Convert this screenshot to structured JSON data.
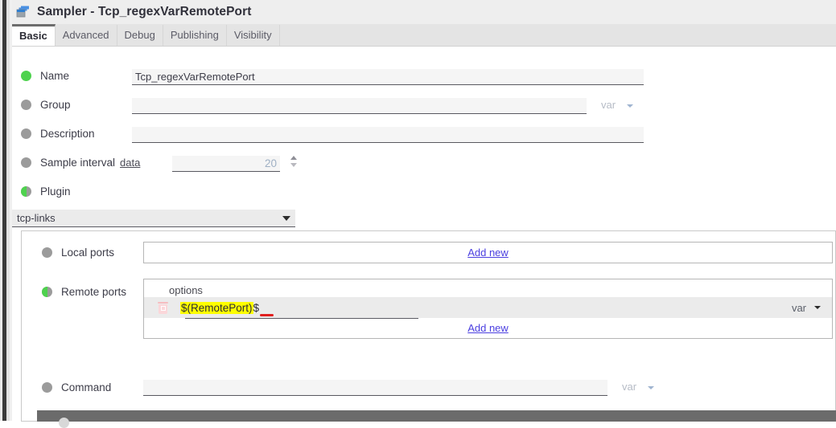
{
  "window": {
    "title": "Sampler - Tcp_regexVarRemotePort",
    "icon": "cascading-windows-icon"
  },
  "tabs": [
    {
      "label": "Basic",
      "active": true
    },
    {
      "label": "Advanced",
      "active": false
    },
    {
      "label": "Debug",
      "active": false
    },
    {
      "label": "Publishing",
      "active": false
    },
    {
      "label": "Visibility",
      "active": false
    }
  ],
  "form": {
    "name": {
      "label": "Name",
      "value": "Tcp_regexVarRemotePort",
      "status": "green"
    },
    "group": {
      "label": "Group",
      "value": "",
      "status": "grey",
      "var_label": "var"
    },
    "description": {
      "label": "Description",
      "value": "",
      "status": "grey"
    },
    "sample_interval": {
      "label": "Sample interval",
      "link": "data",
      "value": "20",
      "status": "grey"
    },
    "plugin": {
      "label": "Plugin",
      "status": "half",
      "selected": "tcp-links"
    }
  },
  "plugin_panel": {
    "local_ports": {
      "label": "Local ports",
      "status": "grey",
      "add_new": "Add new"
    },
    "remote_ports": {
      "label": "Remote ports",
      "status": "half",
      "column_header": "options",
      "rows": [
        {
          "value_highlighted": "$(RemotePort)",
          "value_tail": "$",
          "var_label": "var",
          "delete_icon": "trash-icon",
          "has_error": true
        }
      ],
      "add_new": "Add new"
    },
    "command": {
      "label": "Command",
      "value": "",
      "status": "grey",
      "var_label": "var"
    }
  },
  "colors": {
    "status_on": "#4ed24e",
    "status_off": "#9b9b9b",
    "link": "#4b3fe0",
    "highlight": "#ffff00",
    "error": "#e02020"
  }
}
